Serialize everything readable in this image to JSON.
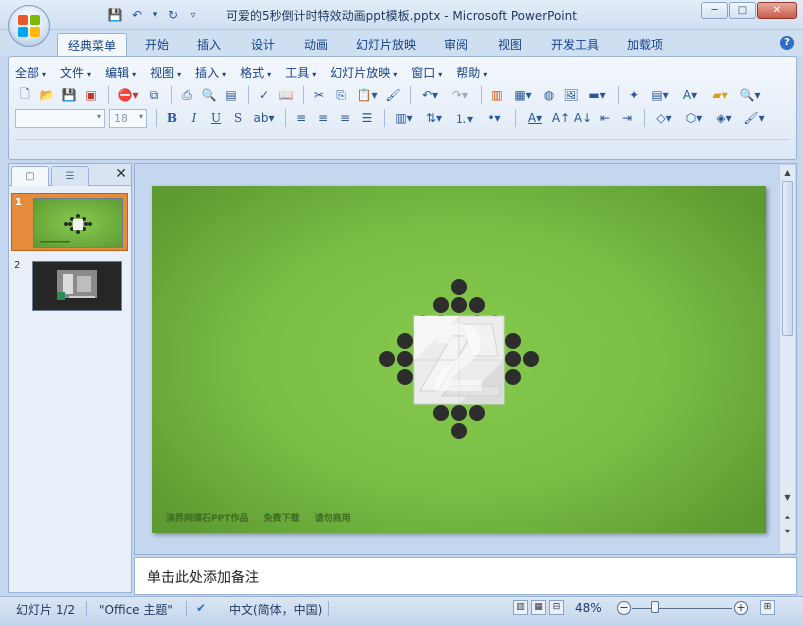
{
  "window": {
    "title": "可爱的5秒倒计时特效动画ppt模板.pptx - Microsoft PowerPoint",
    "minimize": "─",
    "maximize": "□",
    "close": "✕"
  },
  "quick_access": [
    {
      "icon": "save-icon",
      "glyph": "💾"
    },
    {
      "icon": "undo-icon",
      "glyph": "↶"
    },
    {
      "icon": "dropdown-icon",
      "glyph": "▾"
    },
    {
      "icon": "redo-icon",
      "glyph": "↻"
    },
    {
      "icon": "customize-icon",
      "glyph": "⚲"
    }
  ],
  "tabs": [
    "经典菜单",
    "开始",
    "插入",
    "设计",
    "动画",
    "幻灯片放映",
    "审阅",
    "视图",
    "开发工具",
    "加载项"
  ],
  "active_tab": "经典菜单",
  "classic_menu": [
    "全部",
    "文件",
    "编辑",
    "视图",
    "插入",
    "格式",
    "工具",
    "幻灯片放映",
    "窗口",
    "帮助"
  ],
  "font_name": "",
  "font_size": "18",
  "slides_pane": {
    "tab_slides_glyph": "▢",
    "tab_outline_glyph": "☰",
    "close_glyph": "✕",
    "slides": [
      {
        "number": "1",
        "selected": true
      },
      {
        "number": "2",
        "selected": false
      }
    ]
  },
  "slide": {
    "digit": "2",
    "footer": [
      "演界网璞石PPT作品",
      "免费下载",
      "请勿商用"
    ],
    "bg_color": "#79bd44",
    "dot_color": "#2b2b2b"
  },
  "notes": {
    "placeholder": "单击此处添加备注"
  },
  "status": {
    "slide_indicator": "幻灯片 1/2",
    "theme": "\"Office 主题\"",
    "language": "中文(简体，中国)",
    "zoom": "48%",
    "zoom_out": "−",
    "zoom_in": "+"
  }
}
